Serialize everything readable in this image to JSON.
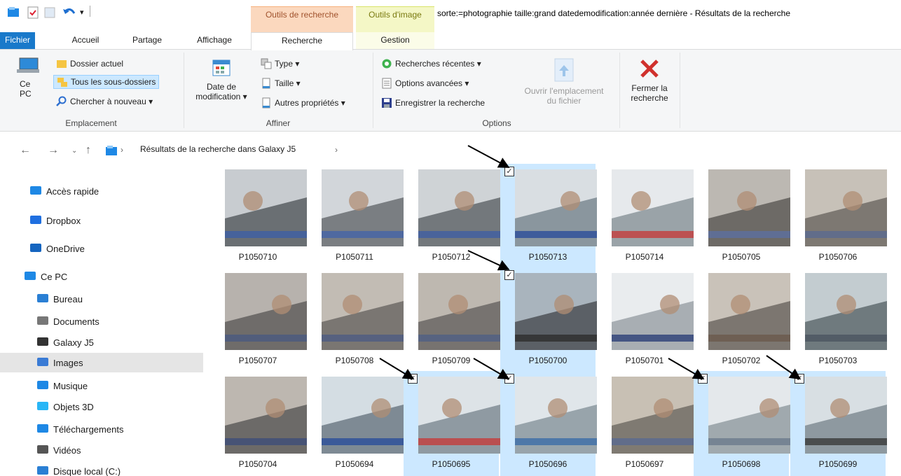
{
  "window": {
    "title": "sorte:=photographie taille:grand datedemodification:année dernière - Résultats de la recherche"
  },
  "context_tabs": {
    "search_tools": "Outils de recherche",
    "image_tools": "Outils d'image"
  },
  "tabs": [
    {
      "label": "Fichier"
    },
    {
      "label": "Accueil"
    },
    {
      "label": "Partage"
    },
    {
      "label": "Affichage"
    },
    {
      "label": "Recherche"
    },
    {
      "label": "Gestion"
    }
  ],
  "ribbon": {
    "location": {
      "label": "Emplacement",
      "this_pc": "Ce PC",
      "current_folder": "Dossier actuel",
      "all_subfolders": "Tous les sous-dossiers",
      "search_again": "Chercher à nouveau ▾"
    },
    "refine": {
      "label": "Affiner",
      "date_modified_1": "Date de",
      "date_modified_2": "modification ▾",
      "type": "Type ▾",
      "size": "Taille ▾",
      "other_props": "Autres propriétés ▾"
    },
    "options": {
      "label": "Options",
      "recent_searches": "Recherches récentes ▾",
      "advanced_options": "Options avancées ▾",
      "save_search": "Enregistrer la recherche",
      "open_location_1": "Ouvrir l'emplacement",
      "open_location_2": "du fichier"
    },
    "close": {
      "label_1": "Fermer la",
      "label_2": "recherche"
    }
  },
  "address_bar": {
    "path": "Résultats de la recherche dans Galaxy J5"
  },
  "sidebar": {
    "items": [
      {
        "label": "Accès rapide",
        "icon": "star-icon"
      },
      {
        "label": "Dropbox",
        "icon": "dropbox-icon"
      },
      {
        "label": "OneDrive",
        "icon": "onedrive-icon"
      },
      {
        "label": "Ce PC",
        "icon": "pc-icon"
      },
      {
        "label": "Bureau",
        "icon": "desktop-icon"
      },
      {
        "label": "Documents",
        "icon": "documents-icon"
      },
      {
        "label": "Galaxy J5",
        "icon": "phone-icon"
      },
      {
        "label": "Images",
        "icon": "images-icon"
      },
      {
        "label": "Musique",
        "icon": "music-icon"
      },
      {
        "label": "Objets 3D",
        "icon": "3d-objects-icon"
      },
      {
        "label": "Téléchargements",
        "icon": "download-icon"
      },
      {
        "label": "Vidéos",
        "icon": "videos-icon"
      },
      {
        "label": "Disque local (C:)",
        "icon": "disk-icon"
      }
    ]
  },
  "files": [
    {
      "name": "P1050710",
      "selected": false
    },
    {
      "name": "P1050711",
      "selected": false
    },
    {
      "name": "P1050712",
      "selected": false
    },
    {
      "name": "P1050713",
      "selected": true
    },
    {
      "name": "P1050714",
      "selected": false
    },
    {
      "name": "P1050705",
      "selected": false
    },
    {
      "name": "P1050706",
      "selected": false
    },
    {
      "name": "P1050707",
      "selected": false
    },
    {
      "name": "P1050708",
      "selected": false
    },
    {
      "name": "P1050709",
      "selected": false
    },
    {
      "name": "P1050700",
      "selected": true
    },
    {
      "name": "P1050701",
      "selected": false
    },
    {
      "name": "P1050702",
      "selected": false
    },
    {
      "name": "P1050703",
      "selected": false
    },
    {
      "name": "P1050704",
      "selected": false
    },
    {
      "name": "P1050694",
      "selected": false
    },
    {
      "name": "P1050695",
      "selected": true
    },
    {
      "name": "P1050696",
      "selected": true
    },
    {
      "name": "P1050697",
      "selected": false
    },
    {
      "name": "P1050698",
      "selected": true
    },
    {
      "name": "P1050699",
      "selected": true
    }
  ],
  "colors": {
    "accent": "#1979ca",
    "selection": "#cce8ff",
    "search_tools_tab": "#f6b17d",
    "image_tools_tab": "#eef5a0",
    "close_red": "#d0312d"
  }
}
